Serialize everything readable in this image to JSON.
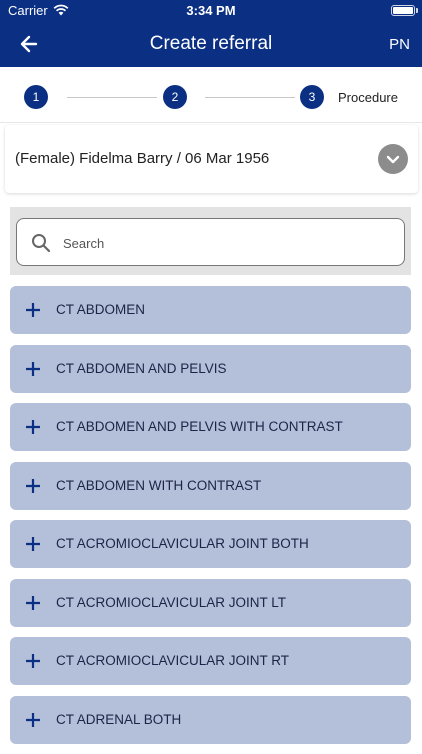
{
  "status_bar": {
    "carrier": "Carrier",
    "time": "3:34 PM"
  },
  "header": {
    "title": "Create referral",
    "initials": "PN",
    "back_icon": "arrow-left-icon"
  },
  "stepper": {
    "steps": [
      {
        "number": "1"
      },
      {
        "number": "2"
      },
      {
        "number": "3",
        "label": "Procedure"
      }
    ]
  },
  "patient": {
    "summary": "(Female) Fidelma Barry / 06 Mar 1956"
  },
  "search": {
    "placeholder": "Search",
    "value": ""
  },
  "procedures": [
    {
      "label": "CT ABDOMEN"
    },
    {
      "label": "CT ABDOMEN AND PELVIS"
    },
    {
      "label": "CT ABDOMEN AND PELVIS WITH CONTRAST"
    },
    {
      "label": "CT ABDOMEN WITH CONTRAST"
    },
    {
      "label": "CT ACROMIOCLAVICULAR JOINT BOTH"
    },
    {
      "label": "CT ACROMIOCLAVICULAR JOINT LT"
    },
    {
      "label": "CT ACROMIOCLAVICULAR JOINT RT"
    },
    {
      "label": "CT ADRENAL BOTH"
    }
  ],
  "colors": {
    "brand": "#0a2f83",
    "item_bg": "#b4bfd9",
    "item_text": "#1b2548"
  }
}
